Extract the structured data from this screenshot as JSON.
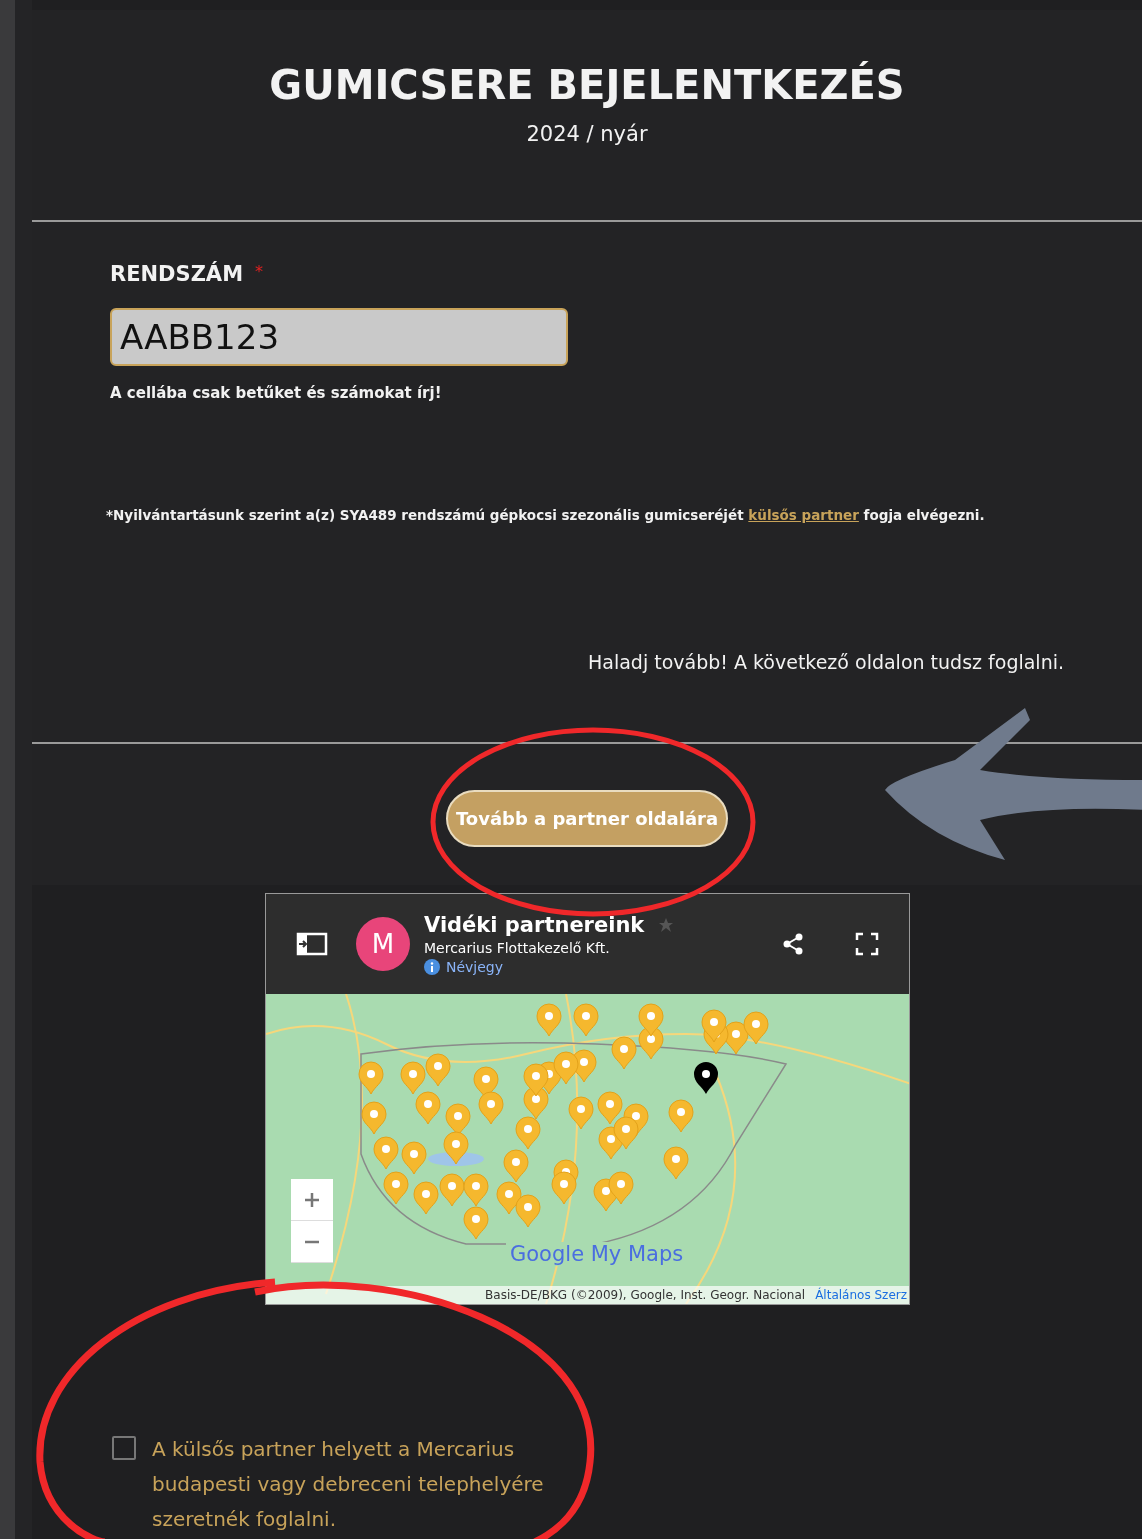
{
  "header": {
    "title": "GUMICSERE BEJELENTKEZÉS",
    "subtitle": "2024 / nyár"
  },
  "form": {
    "label": "RENDSZÁM",
    "required_mark": "*",
    "plate": {
      "value": "AABB123"
    },
    "hint": "A cellába csak betűket és számokat írj!",
    "note": {
      "before": "*Nyilvántartásunk szerint a(z) SYA489 rendszámú gépkocsi szezonális gumicseréjét ",
      "link": "külsős partner",
      "after": " fogja elvégezni."
    },
    "next_hint": "Haladj tovább! A következő oldalon tudsz foglalni."
  },
  "button": "Tovább a partner oldalára",
  "map": {
    "avatar": "M",
    "title": "Vidéki partnereink",
    "owner": "Mercarius Flottakezelő Kft.",
    "info_link": "Névjegy",
    "logo": "Google My Maps",
    "attribution": "Basis-DE/BKG (©2009), Google, Inst. Geogr. Nacional",
    "terms_link": "Általános Szerz"
  },
  "checkbox": {
    "checked": false,
    "label": "A külsős partner helyett a Mercarius budapesti vagy debreceni telephelyére szeretnék foglalni."
  }
}
